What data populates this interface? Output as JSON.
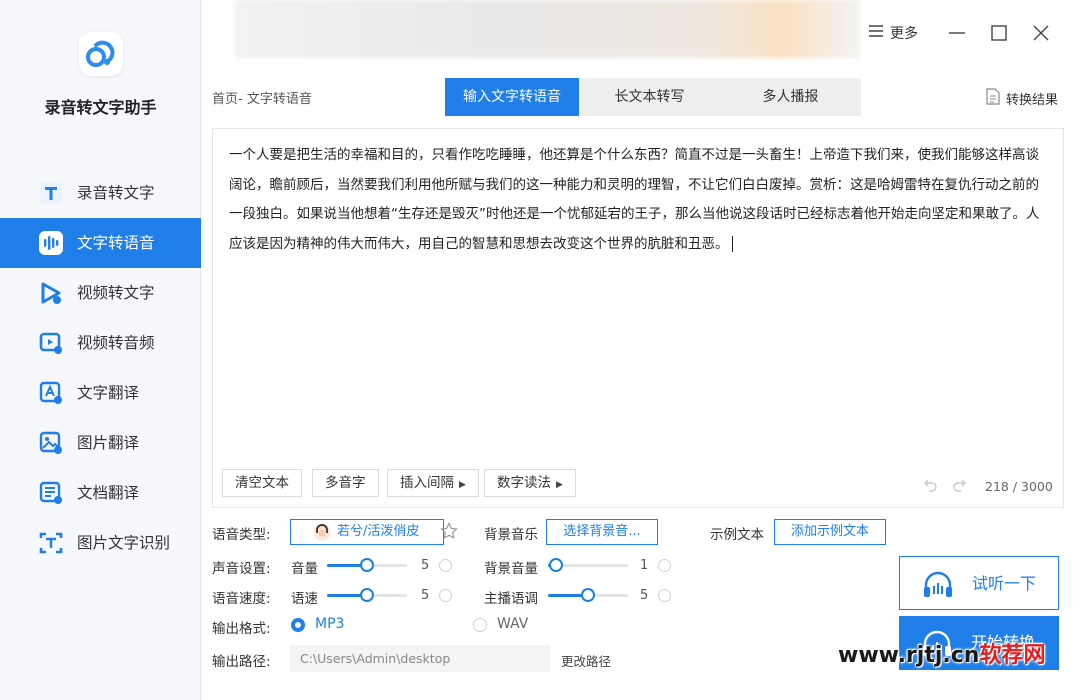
{
  "app": {
    "title": "录音转文字助手"
  },
  "sidebar": {
    "items": [
      {
        "label": "录音转文字",
        "icon": "text-t-icon"
      },
      {
        "label": "文字转语音",
        "icon": "audio-wave-icon",
        "active": true
      },
      {
        "label": "视频转文字",
        "icon": "video-play-icon"
      },
      {
        "label": "视频转音频",
        "icon": "video-audio-icon"
      },
      {
        "label": "文字翻译",
        "icon": "text-translate-icon"
      },
      {
        "label": "图片翻译",
        "icon": "image-translate-icon"
      },
      {
        "label": "文档翻译",
        "icon": "document-translate-icon"
      },
      {
        "label": "图片文字识别",
        "icon": "scan-text-icon"
      }
    ]
  },
  "titlebar": {
    "more_label": "更多"
  },
  "breadcrumb": "首页- 文字转语音",
  "tabs": [
    {
      "label": "输入文字转语音",
      "active": true
    },
    {
      "label": "长文本转写"
    },
    {
      "label": "多人播报"
    }
  ],
  "convert_result_label": "转换结果",
  "editor": {
    "text": "一个人要是把生活的幸福和目的，只看作吃吃睡睡，他还算是个什么东西？简直不过是一头畜生！上帝造下我们来，使我们能够这样高谈阔论，瞻前顾后，当然要我们利用他所赋与我们的这一种能力和灵明的理智，不让它们白白废掉。赏析：这是哈姆雷特在复仇行动之前的一段独白。如果说当他想着“生存还是毁灭”时他还是一个忧郁延宕的王子，那么当他说这段话时已经标志着他开始走向坚定和果敢了。人应该是因为精神的伟大而伟大，用自己的智慧和思想去改变这个世界的肮脏和丑恶。",
    "toolbar": {
      "clear": "清空文本",
      "polyphone": "多音字",
      "insert_pause": "插入间隔",
      "number_reading": "数字读法"
    },
    "char_count": "218 / 3000"
  },
  "settings": {
    "voice_type_label": "语音类型:",
    "voice_name": "若兮/活泼俏皮",
    "bg_music_label": "背景音乐",
    "bg_music_button": "选择背景音...",
    "sample_text_label": "示例文本",
    "sample_text_button": "添加示例文本",
    "sound_settings_label": "声音设置:",
    "volume_label": "音量",
    "volume_value": 5,
    "volume_max": 10,
    "bg_volume_label": "背景音量",
    "bg_volume_value": 1,
    "bg_volume_max": 10,
    "speed_row_label": "语音速度:",
    "speed_label": "语速",
    "speed_value": 5,
    "speed_max": 10,
    "pitch_label": "主播语调",
    "pitch_value": 5,
    "pitch_max": 10,
    "format_label": "输出格式:",
    "format_options": [
      "MP3",
      "WAV"
    ],
    "format_selected": "MP3",
    "path_label": "输出路径:",
    "path_value": "C:\\Users\\Admin\\desktop",
    "change_path": "更改路径"
  },
  "actions": {
    "preview": "试听一下",
    "start": "开始转换"
  },
  "watermark": {
    "domain": "www.rjtj.cn",
    "site": "软荐网"
  },
  "colors": {
    "accent": "#1f7ee8",
    "sidebar_bg": "#f6f8fc"
  }
}
